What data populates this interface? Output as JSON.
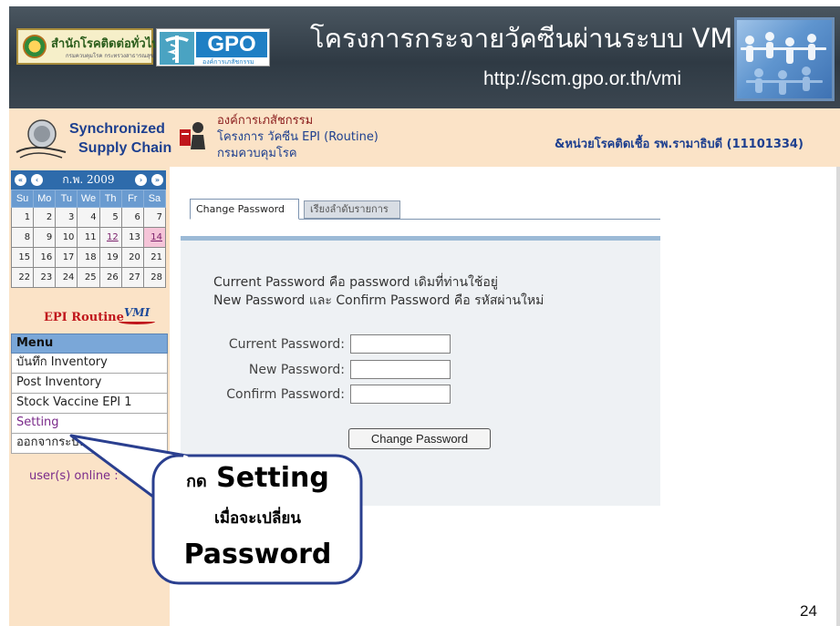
{
  "banner": {
    "logo1_text": "สำนักโรคติดต่อทั่วไป",
    "logo1_subtext": "กรมควบคุมโรค กระทรวงสาธารณสุข",
    "gpo_text": "GPO",
    "gpo_subtext": "องค์การเภสัชกรรม",
    "title": "โครงการกระจายวัคซีนผ่านระบบ VMI",
    "url": "http://scm.gpo.or.th/vmi"
  },
  "subheader": {
    "ssc_line1": "Synchronized",
    "ssc_line2": "Supply Chain",
    "org_line1": "องค์การเภสัชกรรม",
    "org_line2": "โครงการ วัคซีน EPI (Routine)",
    "org_line3": "กรมควบคุมโรค",
    "unit": "&หน่วยโรคติดเชื้อ รพ.รามาธิบดี (11101334)"
  },
  "calendar": {
    "month_label": "ก.พ. 2009",
    "weekdays": [
      "Su",
      "Mo",
      "Tu",
      "We",
      "Th",
      "Fr",
      "Sa"
    ],
    "weeks": [
      [
        "1",
        "2",
        "3",
        "4",
        "5",
        "6",
        "7"
      ],
      [
        "8",
        "9",
        "10",
        "11",
        "12",
        "13",
        "14"
      ],
      [
        "15",
        "16",
        "17",
        "18",
        "19",
        "20",
        "21"
      ],
      [
        "22",
        "23",
        "24",
        "25",
        "26",
        "27",
        "28"
      ]
    ]
  },
  "sidebar": {
    "epi_label": "EPI Routine",
    "vmi_label": "VMI",
    "menu_title": "Menu",
    "menu_items": [
      "บันทึก Inventory",
      "Post Inventory",
      "Stock Vaccine EPI 1",
      "Setting",
      "ออกจากระบบ"
    ],
    "online_text": "user(s) online :"
  },
  "tabs": [
    "Change Password",
    "เรียงลำดับรายการ"
  ],
  "form": {
    "desc_line1": "Current Password คือ password เดิมที่ท่านใช้อยู่",
    "desc_line2": "New Password และ Confirm Password คือ รหัสผ่านใหม่",
    "current_label": "Current Password:",
    "new_label": "New Password:",
    "confirm_label": "Confirm Password:",
    "current_value": "",
    "new_value": "",
    "confirm_value": "",
    "submit_label": "Change Password"
  },
  "callout": {
    "line1_thai": "กด",
    "line1_en": "Setting",
    "line2": "เมื่อจะเปลี่ยน",
    "line3": "Password"
  },
  "page_number": "24",
  "colors": {
    "banner": "#2f3a44",
    "peach": "#fbe3c7",
    "calendar_header": "#2e6bab",
    "menu_header": "#7aa7d8",
    "callout_border": "#2a3f8f"
  }
}
